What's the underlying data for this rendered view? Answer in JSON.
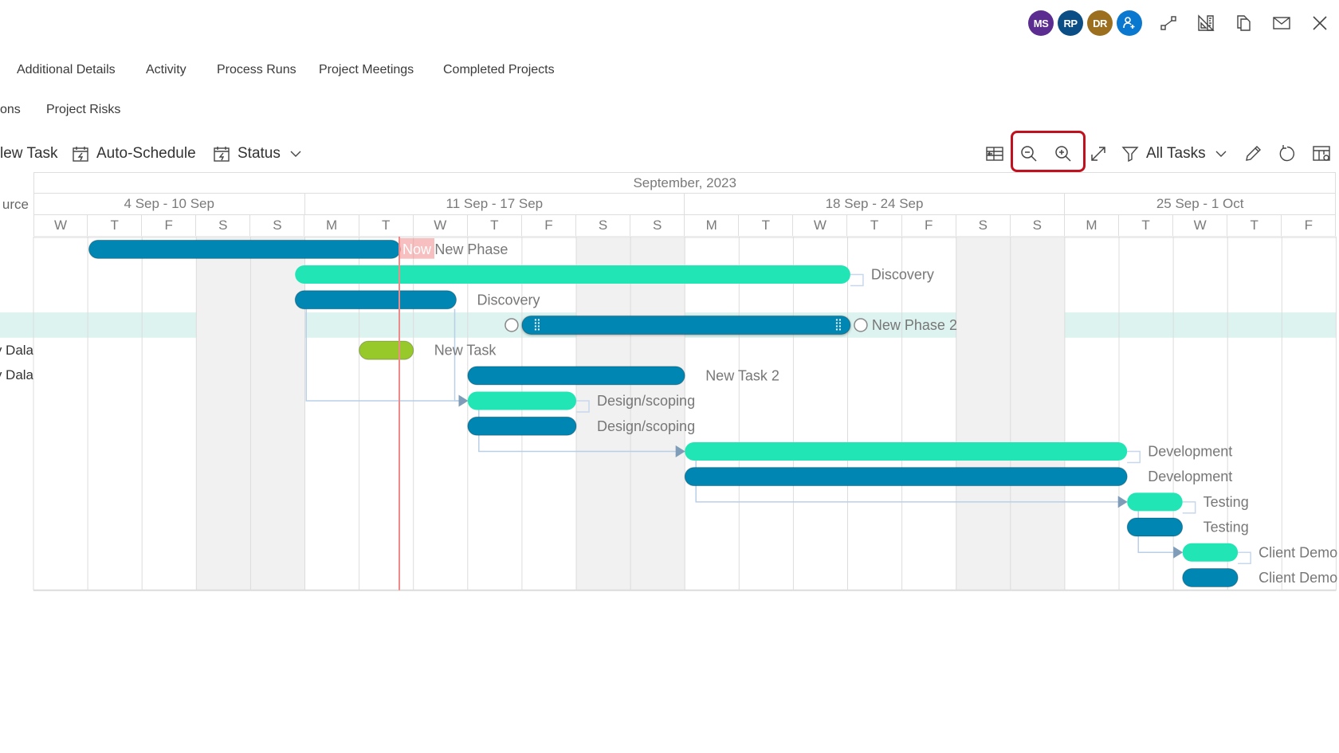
{
  "topbar": {
    "avatars": [
      {
        "initials": "MS",
        "color": "#5b2d91"
      },
      {
        "initials": "RP",
        "color": "#0b4d85"
      },
      {
        "initials": "DR",
        "color": "#9c6f1f"
      }
    ],
    "add_user_color": "#0b78d0",
    "icons": [
      "dependency-link-icon",
      "ruler-triangle-icon",
      "copy-icon",
      "mail-icon",
      "close-icon"
    ]
  },
  "tabs_row1": [
    "Additional Details",
    "Activity",
    "Process Runs",
    "Project Meetings",
    "Completed Projects"
  ],
  "tabs_row2": [
    "ons",
    "Project Risks"
  ],
  "toolbar": {
    "new_task": "lew Task",
    "auto_schedule": "Auto-Schedule",
    "status": "Status",
    "filter": "All Tasks"
  },
  "colors": {
    "accent_blue": "#0086b3",
    "accent_green": "#22e5b5",
    "accent_lime": "#97c92a",
    "now_line": "#f08a8a",
    "selected_row": "#dcf3ef",
    "weekend": "#f1f1f1",
    "highlight_box": "#c0111f"
  },
  "chart_data": {
    "type": "gantt",
    "title": "September, 2023",
    "resource_header": "urce",
    "weeks": [
      {
        "label": "4 Sep - 10 Sep",
        "days": 5
      },
      {
        "label": "11 Sep - 17 Sep",
        "days": 7
      },
      {
        "label": "18 Sep - 24 Sep",
        "days": 7
      },
      {
        "label": "25 Sep - 1 Oct",
        "days": 5
      }
    ],
    "days": [
      "W",
      "T",
      "F",
      "S",
      "S",
      "M",
      "T",
      "W",
      "T",
      "F",
      "S",
      "S",
      "M",
      "T",
      "W",
      "T",
      "F",
      "S",
      "S",
      "M",
      "T",
      "W",
      "T",
      "F"
    ],
    "weekend_indices": [
      3,
      4,
      10,
      11,
      17,
      18
    ],
    "now_day": 6.74,
    "now_label": "Now",
    "selected_row": 3,
    "resources": [
      "",
      "",
      "",
      "",
      "y Dala",
      "y Dala",
      "",
      "",
      "",
      "",
      "",
      "",
      "",
      ""
    ],
    "tasks": [
      {
        "label": "New Phase",
        "start": 1.02,
        "end": 6.76,
        "kind": "blue"
      },
      {
        "label": "Discovery",
        "start": 4.82,
        "end": 15.05,
        "kind": "green"
      },
      {
        "label": "Discovery",
        "start": 4.82,
        "end": 7.79,
        "kind": "blue"
      },
      {
        "label": "New Phase 2",
        "start": 9.0,
        "end": 15.05,
        "kind": "blue",
        "selected": true
      },
      {
        "label": "New Task",
        "start": 6.0,
        "end": 7.0,
        "kind": "lime"
      },
      {
        "label": "New Task 2",
        "start": 8.0,
        "end": 12.0,
        "kind": "blue"
      },
      {
        "label": "Design/scoping",
        "start": 8.0,
        "end": 10.0,
        "kind": "green"
      },
      {
        "label": "Design/scoping",
        "start": 8.0,
        "end": 10.0,
        "kind": "blue"
      },
      {
        "label": "Development",
        "start": 12.0,
        "end": 20.15,
        "kind": "green"
      },
      {
        "label": "Development",
        "start": 12.0,
        "end": 20.15,
        "kind": "blue"
      },
      {
        "label": "Testing",
        "start": 20.15,
        "end": 21.17,
        "kind": "green"
      },
      {
        "label": "Testing",
        "start": 20.15,
        "end": 21.17,
        "kind": "blue"
      },
      {
        "label": "Client Demo a",
        "start": 21.17,
        "end": 22.19,
        "kind": "green"
      },
      {
        "label": "Client Demo a",
        "start": 21.17,
        "end": 22.19,
        "kind": "blue"
      }
    ],
    "dependencies": [
      {
        "from": 2,
        "to": 6
      },
      {
        "from": 6,
        "to": 8
      },
      {
        "from": 8,
        "to": 10
      },
      {
        "from": 10,
        "to": 12
      }
    ]
  }
}
